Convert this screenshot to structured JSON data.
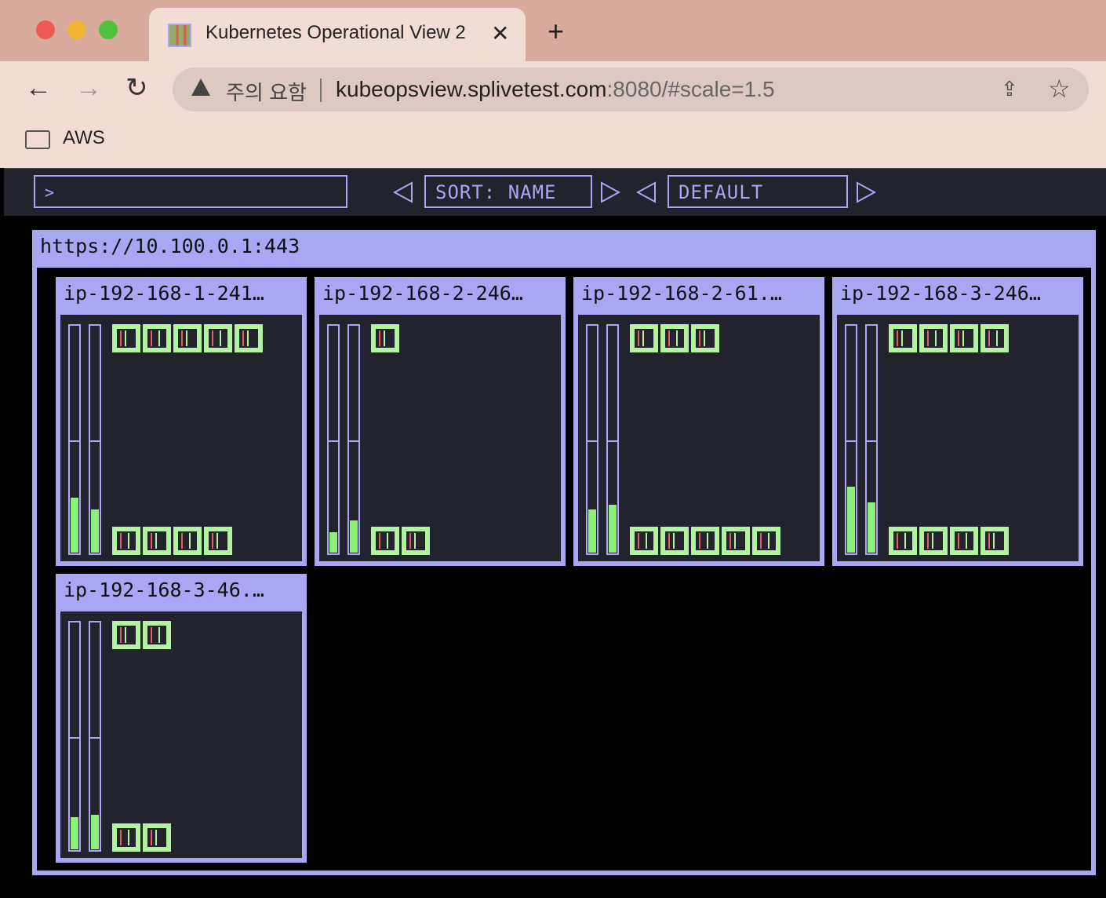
{
  "browser": {
    "tab_title": "Kubernetes Operational View 2",
    "tab_close": "✕",
    "new_tab": "+",
    "back": "←",
    "forward": "→",
    "reload": "↻",
    "warning_text": "주의 요함",
    "url_host": "kubeopsview.splivetest.com",
    "url_rest": ":8080/#scale=1.5",
    "bookmark": "AWS",
    "icons": [
      "kube-favicon-icon",
      "warning-icon",
      "share-icon",
      "star-icon",
      "folder-icon"
    ]
  },
  "toolbar": {
    "filter_prompt": ">",
    "sort_label": "SORT: NAME",
    "theme_label": "DEFAULT"
  },
  "cluster": {
    "title": "https://10.100.0.1:443",
    "nodes": [
      {
        "name": "ip-192-168-1-241…",
        "cpu": 0.24,
        "mem": 0.19,
        "top_pods": 5,
        "bottom_pods": 4
      },
      {
        "name": "ip-192-168-2-246…",
        "cpu": 0.09,
        "mem": 0.14,
        "top_pods": 1,
        "bottom_pods": 2
      },
      {
        "name": "ip-192-168-2-61.…",
        "cpu": 0.19,
        "mem": 0.21,
        "top_pods": 3,
        "bottom_pods": 5
      },
      {
        "name": "ip-192-168-3-246…",
        "cpu": 0.29,
        "mem": 0.22,
        "top_pods": 4,
        "bottom_pods": 4
      },
      {
        "name": "ip-192-168-3-46.…",
        "cpu": 0.14,
        "mem": 0.15,
        "top_pods": 2,
        "bottom_pods": 2
      }
    ]
  },
  "colors": {
    "accent": "#a9a6f4",
    "panel": "#23232e",
    "pod_green": "#b3f2a1",
    "usage_green": "#8cf07a",
    "pod_red": "#e35d5d"
  }
}
